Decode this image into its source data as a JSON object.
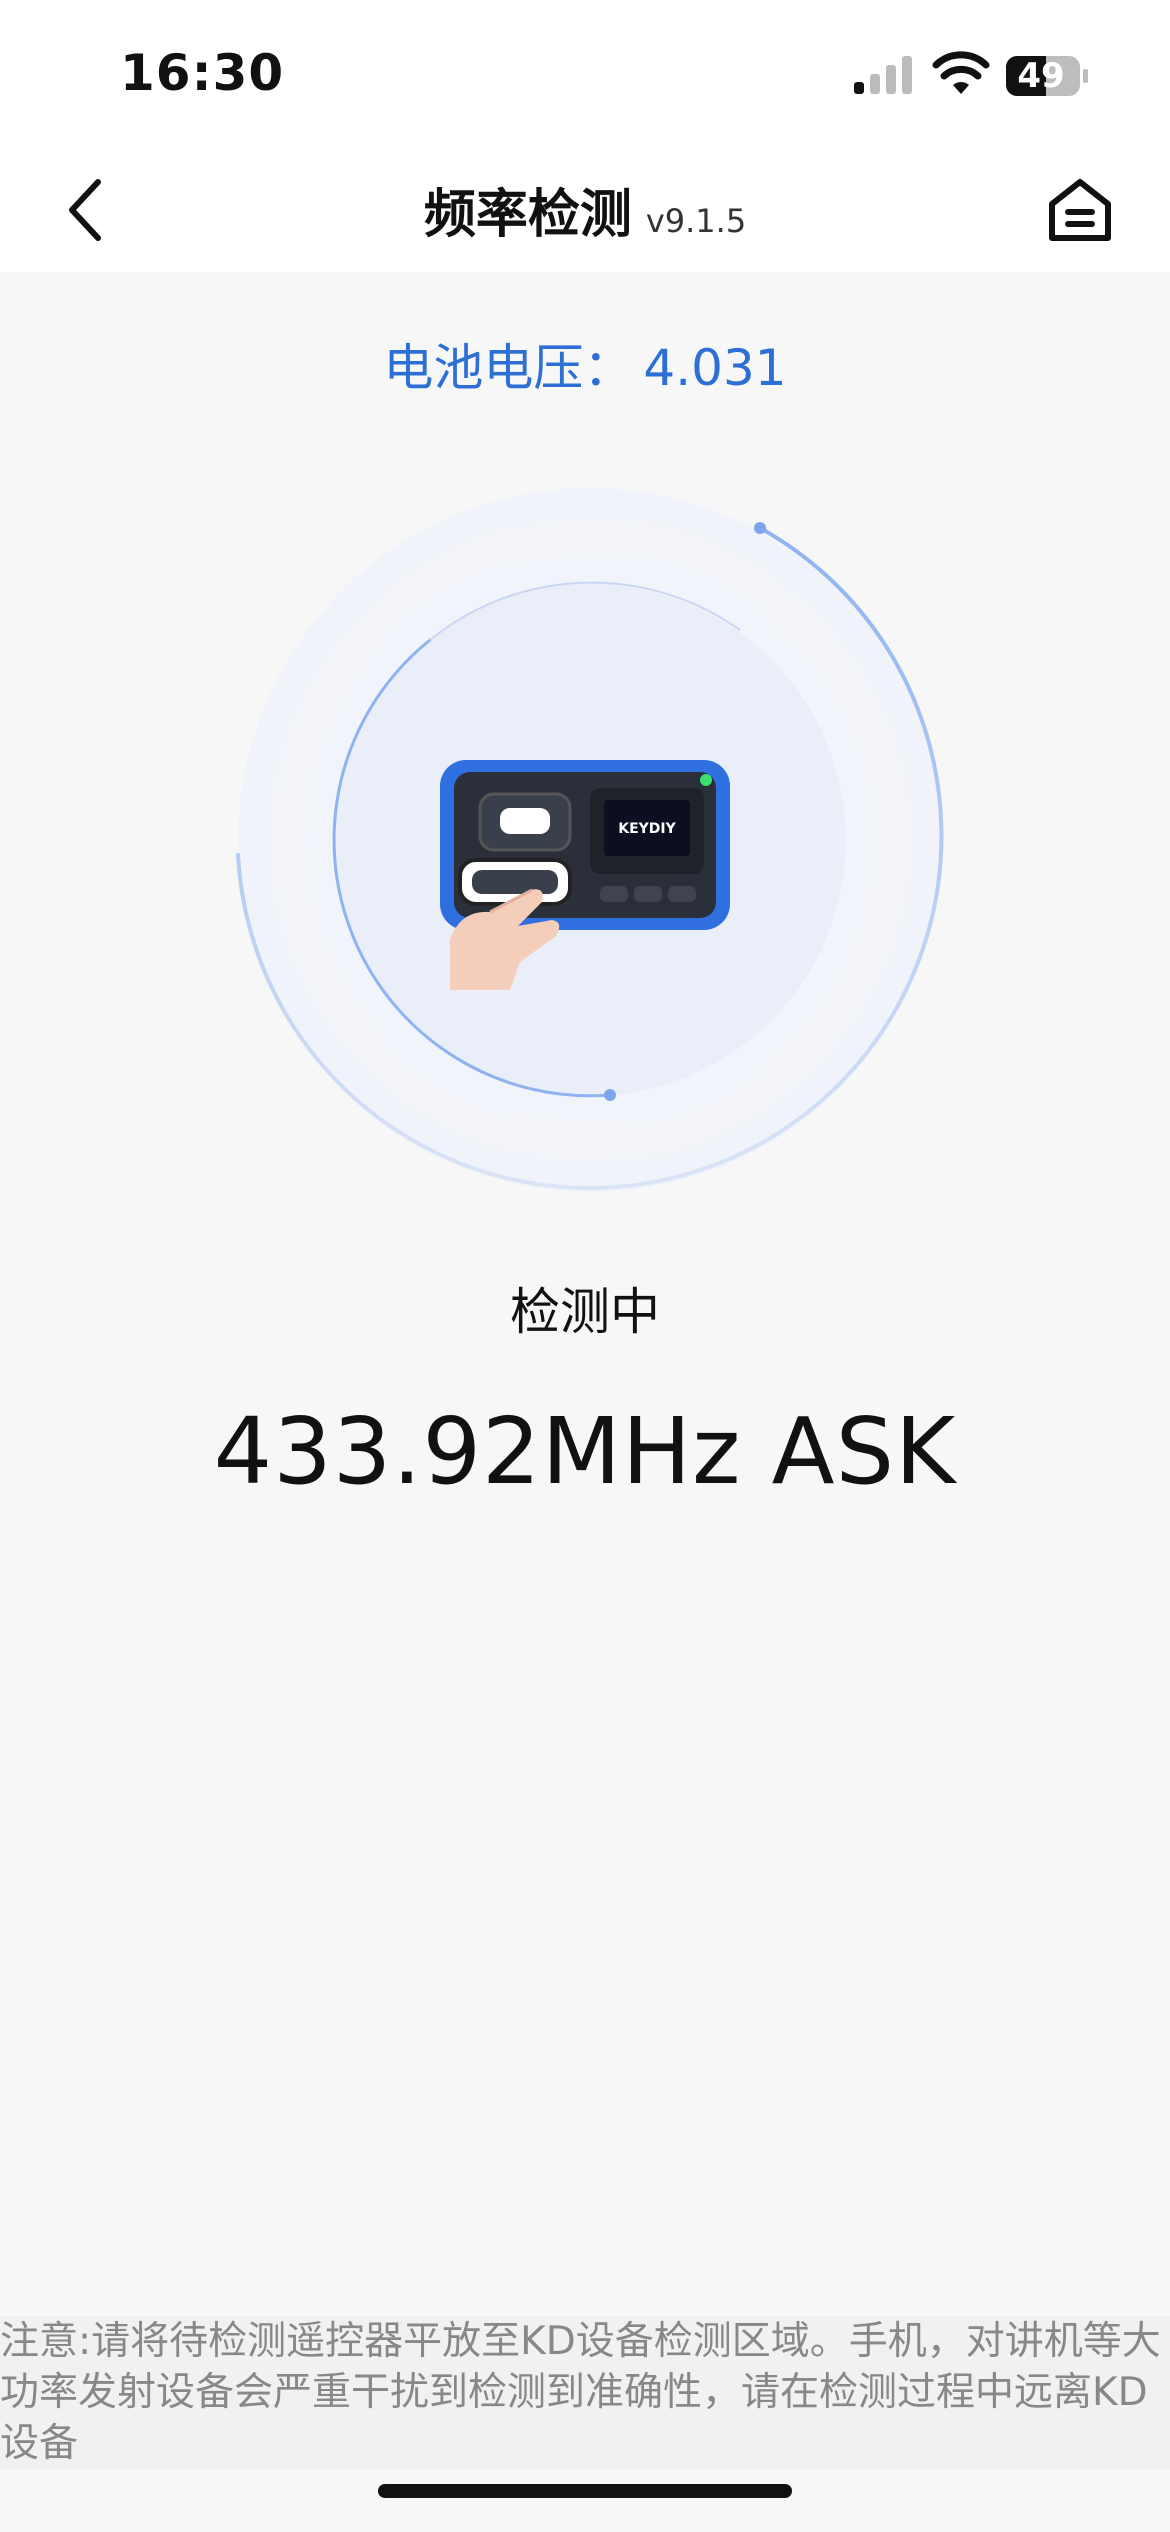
{
  "status_bar": {
    "time": "16:30",
    "battery_level": "49",
    "icons": [
      "signal-icon",
      "wifi-icon",
      "battery-icon"
    ]
  },
  "nav": {
    "title": "频率检测",
    "version": "v9.1.5",
    "back_icon": "chevron-left-icon",
    "home_icon": "home-icon"
  },
  "voltage": {
    "label": "电池电压：",
    "value": "4.031"
  },
  "scan": {
    "state": "检测中",
    "frequency": "433.92MHz ASK",
    "device_screen_brand": "KEYDIY",
    "accent_color": "#2e6fd6",
    "device_color": "#2f6fe0"
  },
  "notice": {
    "text": "注意:请将待检测遥控器平放至KD设备检测区域。手机，对讲机等大功率发射设备会严重干扰到检测到准确性，请在检测过程中远离KD设备"
  }
}
